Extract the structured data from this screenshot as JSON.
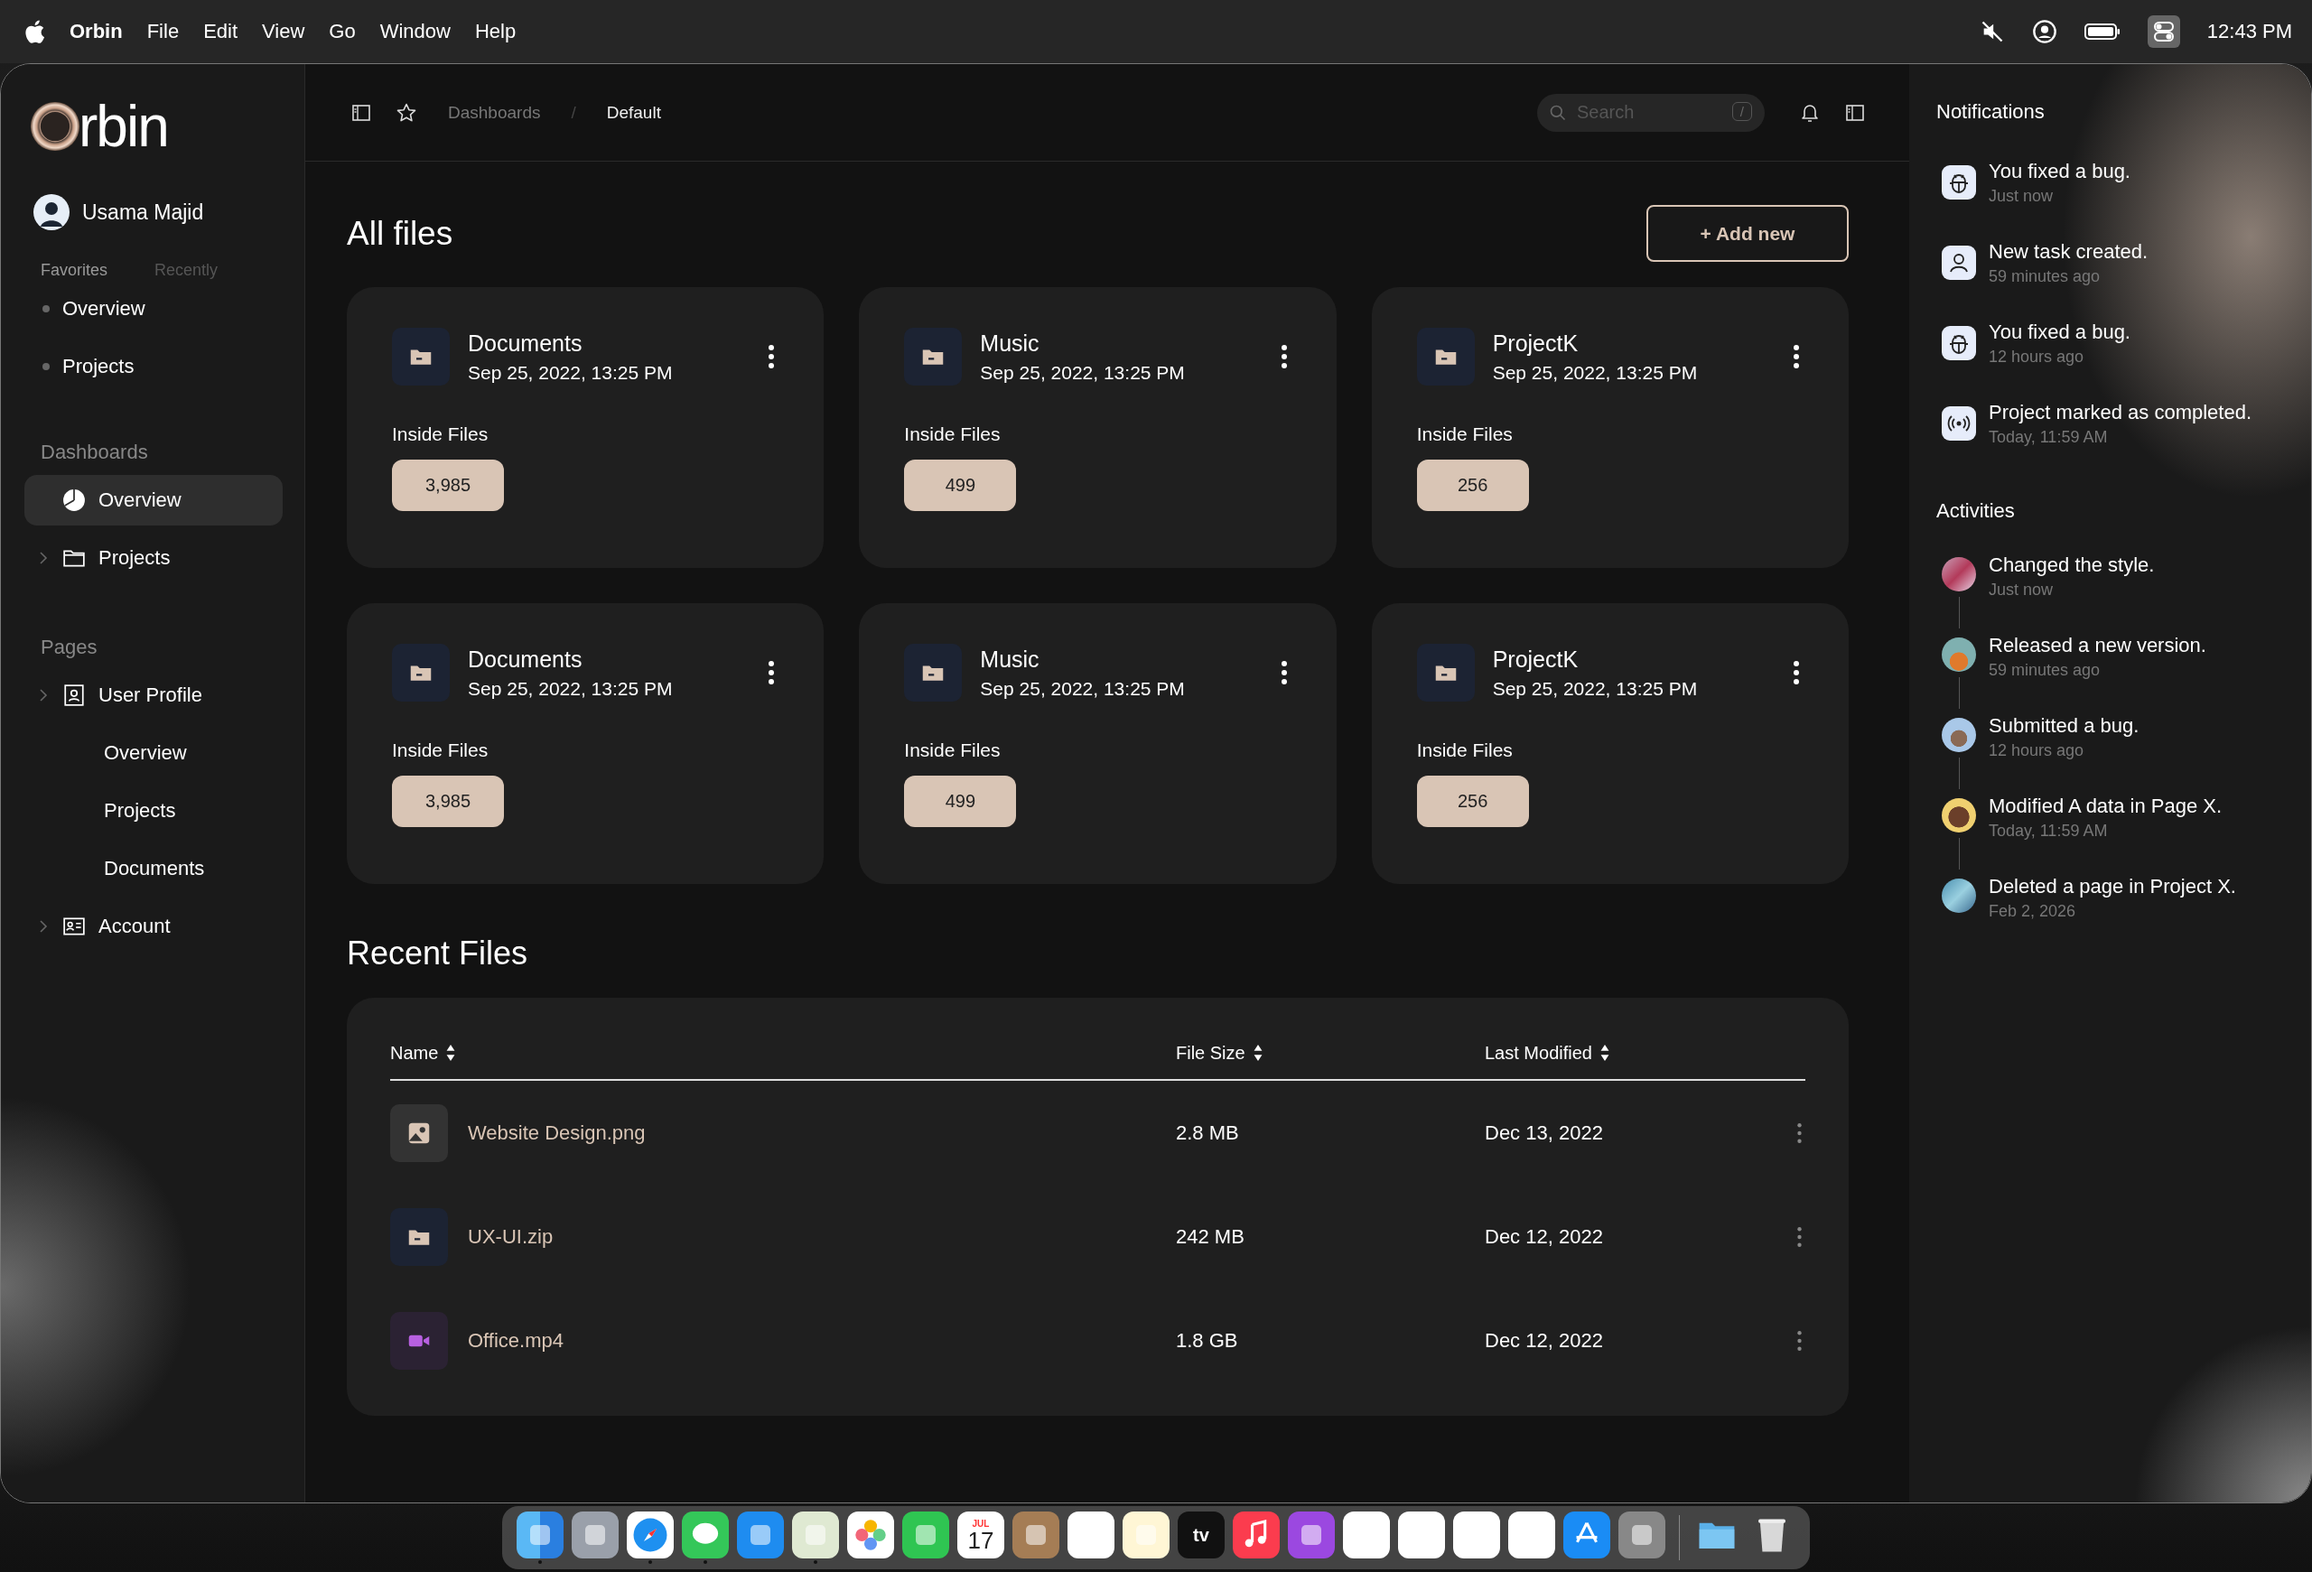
{
  "menubar": {
    "app": "Orbin",
    "menus": [
      "File",
      "Edit",
      "View",
      "Go",
      "Window",
      "Help"
    ],
    "time": "12:43 PM"
  },
  "sidebar": {
    "logo_text": "rbin",
    "user": "Usama Majid",
    "tabs": [
      {
        "label": "Favorites",
        "selected": true
      },
      {
        "label": "Recently",
        "selected": false
      }
    ],
    "favorites": [
      "Overview",
      "Projects"
    ],
    "dashboards": {
      "heading": "Dashboards",
      "items": [
        {
          "label": "Overview",
          "selected": true,
          "expandable": false
        },
        {
          "label": "Projects",
          "selected": false,
          "expandable": true
        }
      ]
    },
    "pages": {
      "heading": "Pages",
      "items": [
        {
          "label": "User Profile",
          "expandable": true,
          "children": [
            "Overview",
            "Projects",
            "Documents"
          ]
        },
        {
          "label": "Account",
          "expandable": true
        }
      ]
    }
  },
  "header": {
    "breadcrumbs": [
      "Dashboards",
      "Default"
    ],
    "separator": "/",
    "search": {
      "placeholder": "Search",
      "shortcut": "/"
    }
  },
  "main": {
    "title": "All files",
    "add_button": "+ Add new",
    "folders": [
      {
        "name": "Documents",
        "date": "Sep 25, 2022, 13:25 PM",
        "inside_label": "Inside Files",
        "count": "3,985"
      },
      {
        "name": "Music",
        "date": "Sep 25, 2022, 13:25 PM",
        "inside_label": "Inside Files",
        "count": "499"
      },
      {
        "name": "ProjectK",
        "date": "Sep 25, 2022, 13:25 PM",
        "inside_label": "Inside Files",
        "count": "256"
      },
      {
        "name": "Documents",
        "date": "Sep 25, 2022, 13:25 PM",
        "inside_label": "Inside Files",
        "count": "3,985"
      },
      {
        "name": "Music",
        "date": "Sep 25, 2022, 13:25 PM",
        "inside_label": "Inside Files",
        "count": "499"
      },
      {
        "name": "ProjectK",
        "date": "Sep 25, 2022, 13:25 PM",
        "inside_label": "Inside Files",
        "count": "256"
      }
    ],
    "recent": {
      "title": "Recent Files",
      "columns": [
        "Name",
        "File Size",
        "Last Modified"
      ],
      "rows": [
        {
          "kind": "image",
          "name": "Website Design.png",
          "size": "2.8 MB",
          "modified": "Dec 13, 2022"
        },
        {
          "kind": "archive",
          "name": "UX-UI.zip",
          "size": "242 MB",
          "modified": "Dec 12, 2022"
        },
        {
          "kind": "video",
          "name": "Office.mp4",
          "size": "1.8 GB",
          "modified": "Dec 12, 2022"
        }
      ]
    }
  },
  "notifications": {
    "title": "Notifications",
    "items": [
      {
        "kind": "bug",
        "text": "You fixed a bug.",
        "time": "Just now"
      },
      {
        "kind": "task",
        "text": "New task created.",
        "time": "59 minutes ago"
      },
      {
        "kind": "bug",
        "text": "You fixed a bug.",
        "time": "12 hours ago"
      },
      {
        "kind": "status",
        "text": "Project marked as completed.",
        "time": "Today, 11:59 AM"
      }
    ]
  },
  "activities": {
    "title": "Activities",
    "items": [
      {
        "text": "Changed the style.",
        "time": "Just now"
      },
      {
        "text": "Released a new version.",
        "time": "59 minutes ago"
      },
      {
        "text": "Submitted a bug.",
        "time": "12 hours ago"
      },
      {
        "text": "Modified A data in Page X.",
        "time": "Today, 11:59 AM"
      },
      {
        "text": "Deleted a page in Project X.",
        "time": "Feb 2, 2026"
      }
    ]
  },
  "dock": [
    {
      "kind": "finder",
      "running": true
    },
    {
      "kind": "launchpad",
      "running": false
    },
    {
      "kind": "safari",
      "running": true
    },
    {
      "kind": "messages",
      "running": true
    },
    {
      "kind": "mail",
      "running": false
    },
    {
      "kind": "maps",
      "running": true
    },
    {
      "kind": "photos",
      "running": false
    },
    {
      "kind": "facetime",
      "running": false
    },
    {
      "kind": "calendar",
      "running": false,
      "month": "JUL",
      "day": "17"
    },
    {
      "kind": "contacts",
      "running": false
    },
    {
      "kind": "reminders",
      "running": false
    },
    {
      "kind": "notes",
      "running": false
    },
    {
      "kind": "tv",
      "running": false,
      "label": "tv"
    },
    {
      "kind": "music",
      "running": false
    },
    {
      "kind": "podcasts",
      "running": false
    },
    {
      "kind": "news",
      "running": false
    },
    {
      "kind": "keynote",
      "running": false
    },
    {
      "kind": "pages",
      "running": false
    },
    {
      "kind": "numbers",
      "running": false
    },
    {
      "kind": "appstore",
      "running": false
    },
    {
      "kind": "settings",
      "running": false
    },
    {
      "kind": "folder",
      "running": false
    },
    {
      "kind": "trash",
      "running": false
    }
  ]
}
